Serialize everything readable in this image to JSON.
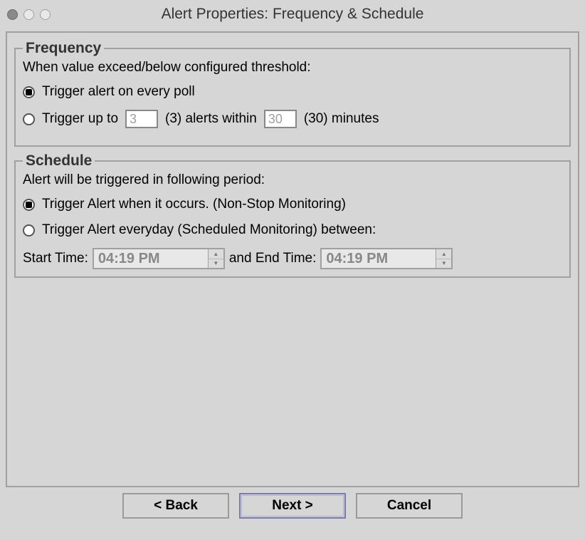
{
  "window": {
    "title": "Alert Properties: Frequency & Schedule"
  },
  "frequency": {
    "legend": "Frequency",
    "desc": "When value exceed/below configured threshold:",
    "opt1_label": "Trigger alert on every poll",
    "opt2_prefix": "Trigger up to",
    "opt2_count_value": "3",
    "opt2_mid1": "(3) alerts within",
    "opt2_minutes_value": "30",
    "opt2_suffix": "(30) minutes"
  },
  "schedule": {
    "legend": "Schedule",
    "desc": "Alert will be triggered in following period:",
    "opt1_label": "Trigger Alert when it occurs. (Non-Stop Monitoring)",
    "opt2_label": "Trigger Alert everyday (Scheduled Monitoring) between:",
    "start_label": "Start Time:",
    "start_value": "04:19 PM",
    "connector": "and End Time:",
    "end_value": "04:19 PM"
  },
  "buttons": {
    "back": "< Back",
    "next": "Next >",
    "cancel": "Cancel"
  }
}
